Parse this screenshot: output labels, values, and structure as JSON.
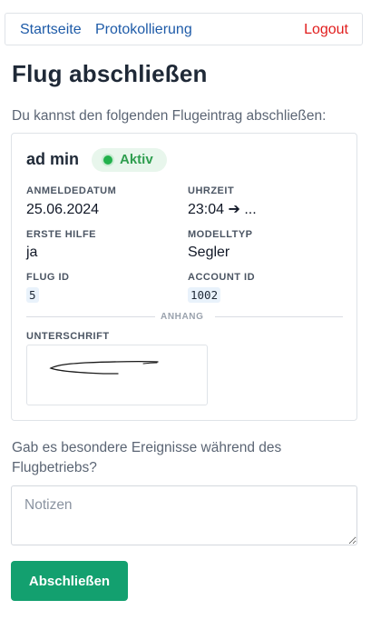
{
  "nav": {
    "home_label": "Startseite",
    "log_label": "Protokollierung",
    "logout_label": "Logout"
  },
  "page": {
    "title": "Flug abschließen",
    "intro": "Du kannst den folgenden Flugeintrag abschließen:"
  },
  "entry": {
    "user": "ad min",
    "status": "Aktiv",
    "fields": {
      "anmeldedatum": {
        "label": "ANMELDEDATUM",
        "value": "25.06.2024"
      },
      "uhrzeit": {
        "label": "UHRZEIT",
        "value": "23:04 ➔ ..."
      },
      "erste_hilfe": {
        "label": "ERSTE HILFE",
        "value": "ja"
      },
      "modelltyp": {
        "label": "MODELLTYP",
        "value": "Segler"
      },
      "flug_id": {
        "label": "FLUG ID",
        "value": "5"
      },
      "account_id": {
        "label": "ACCOUNT ID",
        "value": "1002"
      }
    },
    "attachment_label": "ANHANG",
    "signature_label": "UNTERSCHRIFT"
  },
  "form": {
    "question": "Gab es besondere Ereignisse während des Flugbetriebs?",
    "notes_placeholder": "Notizen",
    "notes_value": "",
    "submit_label": "Abschließen"
  },
  "colors": {
    "accent": "#13a06f",
    "link": "#1e5ba8",
    "logout": "#e11d1d",
    "status": "#22b14c"
  }
}
